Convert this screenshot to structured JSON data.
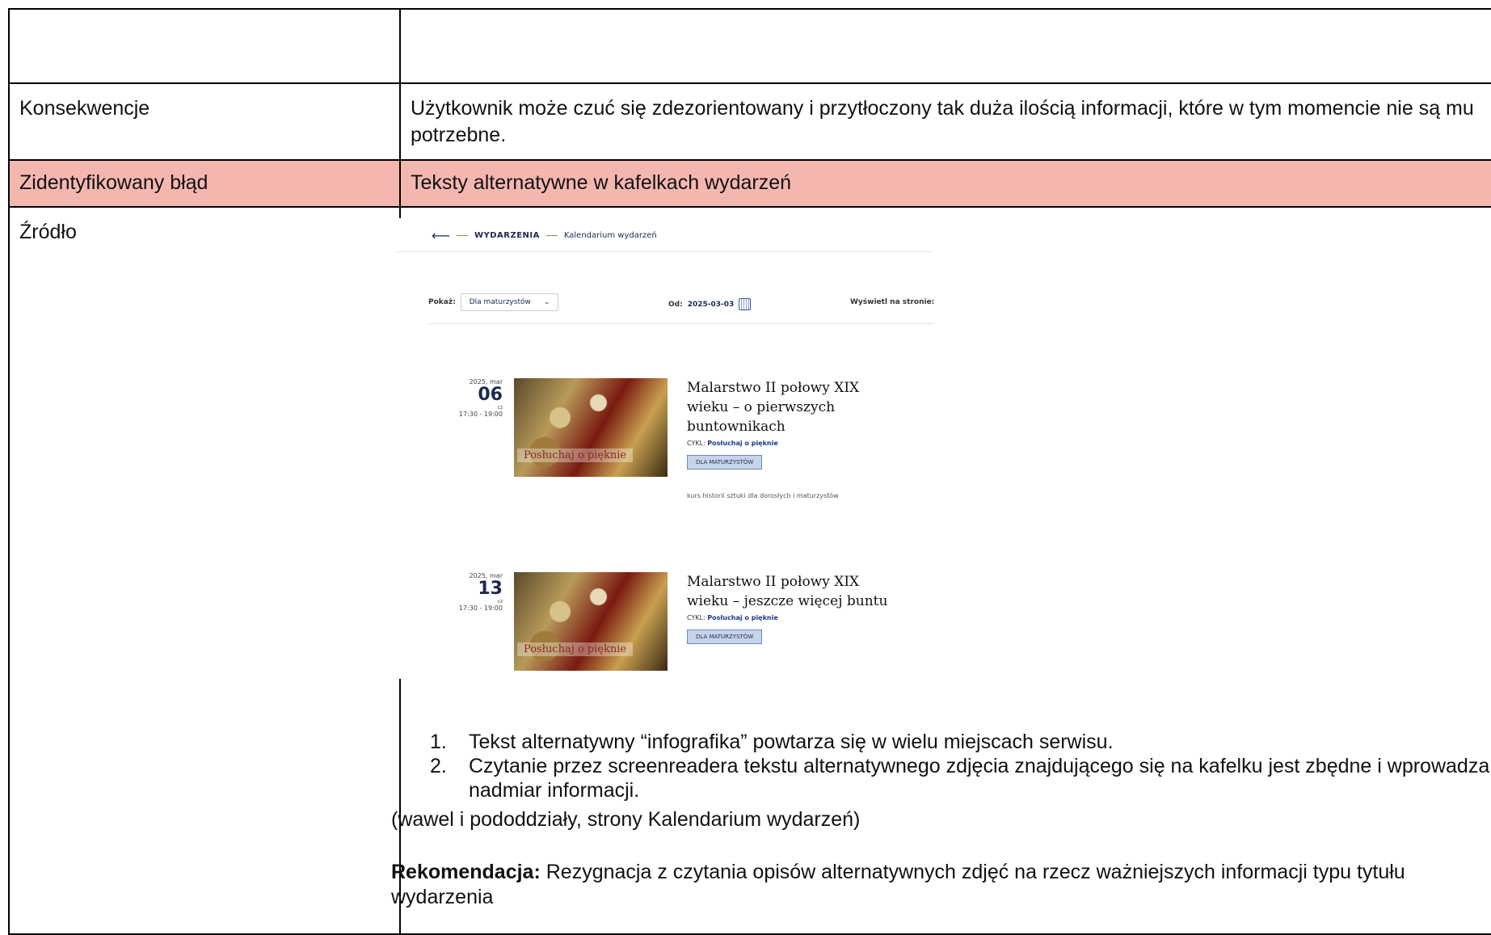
{
  "rows": {
    "consequences": {
      "label": "Konsekwencje",
      "text": "Użytkownik może czuć się zdezorientowany i przytłoczony tak duża ilością informacji, które w tym momencie nie są mu potrzebne."
    },
    "error": {
      "label": "Zidentyfikowany błąd",
      "text": "Teksty alternatywne w kafelkach wydarzeń",
      "highlight_color": "#f4b7b0"
    },
    "source": {
      "label": "Źródło"
    }
  },
  "screenshot": {
    "breadcrumb": {
      "back_icon": "arrow-left-icon",
      "section": "WYDARZENIA",
      "page": "Kalendarium wydarzeń"
    },
    "filters": {
      "show_label": "Pokaż:",
      "show_value": "Dla maturzystów",
      "from_label": "Od:",
      "from_value": "2025-03-03",
      "per_page_label": "Wyświetl na stronie:"
    },
    "events": [
      {
        "year_month": "2025, mar",
        "day": "06",
        "weekday": "cz",
        "time": "17:30 - 19:00",
        "image_caption": "Posłuchaj o pięknie",
        "title": "Malarstwo II połowy XIX wieku – o pierwszych buntownikach",
        "cycle_label": "CYKL:",
        "cycle_name": "Posłuchaj o pięknie",
        "tag": "DLA MATURZYSTÓW",
        "description": "kurs historii sztuki dla dorosłych i maturzystów"
      },
      {
        "year_month": "2025, mar",
        "day": "13",
        "weekday": "cz",
        "time": "17:30 - 19:00",
        "image_caption": "Posłuchaj o pięknie",
        "title": "Malarstwo II połowy XIX wieku – jeszcze więcej buntu",
        "cycle_label": "CYKL:",
        "cycle_name": "Posłuchaj o pięknie",
        "tag": "DLA MATURZYSTÓW"
      }
    ]
  },
  "findings": [
    {
      "num": "1.",
      "text": "Tekst alternatywny “infografika” powtarza się w wielu miejscach serwisu."
    },
    {
      "num": "2.",
      "text": "Czytanie przez screenreadera tekstu alternatywnego zdjęcia znajdującego się na kafelku jest zbędne i wprowadza nadmiar informacji."
    }
  ],
  "scope_note": "(wawel i pododdziały, strony Kalendarium wydarzeń)",
  "recommendation": {
    "label": "Rekomendacja:",
    "text": " Rezygnacja z czytania opisów alternatywnych zdjęć na rzecz ważniejszych informacji typu tytułu wydarzenia"
  }
}
